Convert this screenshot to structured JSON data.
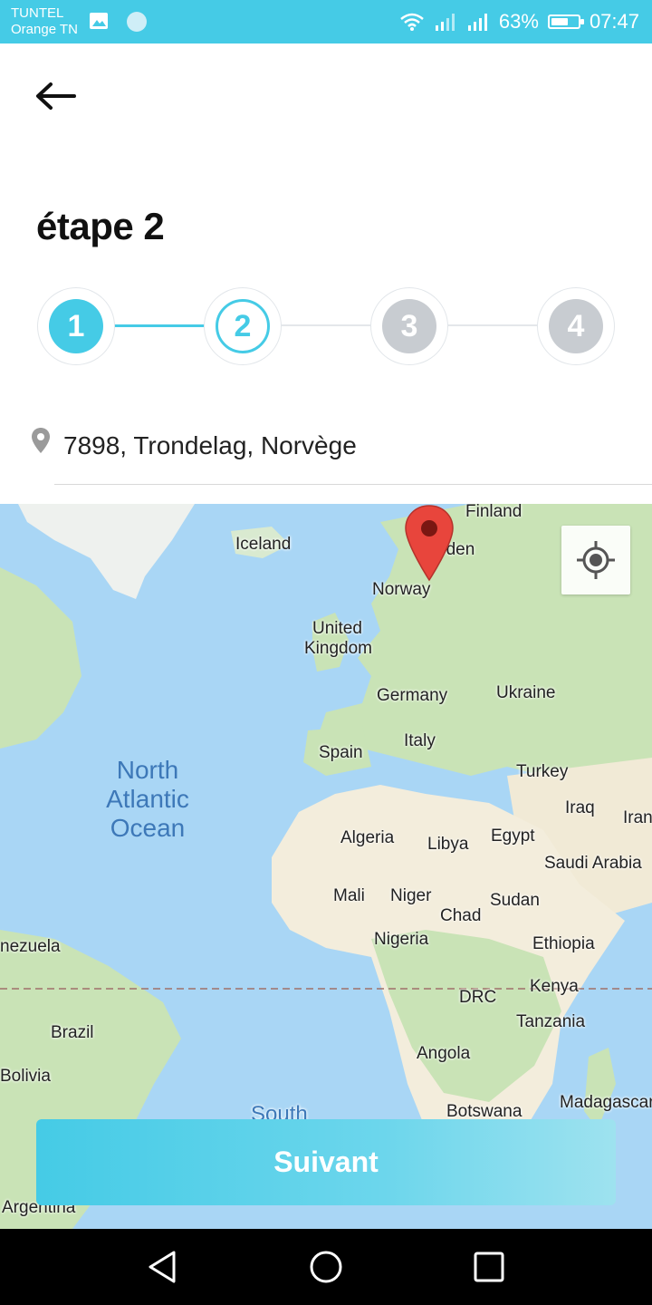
{
  "status_bar": {
    "carrier_line1": "TUNTEL",
    "carrier_line2": "Orange TN",
    "battery_percent": "63%",
    "battery_level": 0.63,
    "time": "07:47",
    "background_color": "#45cbe6"
  },
  "header": {
    "back_icon": "arrow-left-icon",
    "title": "étape 2"
  },
  "stepper": {
    "active_color": "#45cbe6",
    "inactive_color": "#c8ccd1",
    "steps": [
      {
        "label": "1",
        "state": "completed"
      },
      {
        "label": "2",
        "state": "current"
      },
      {
        "label": "3",
        "state": "upcoming"
      },
      {
        "label": "4",
        "state": "upcoming"
      }
    ]
  },
  "address": {
    "icon": "location-pin-icon",
    "value": "7898, Trondelag, Norvège"
  },
  "map": {
    "labels": {
      "finland": "Finland",
      "iceland": "Iceland",
      "sweden": "eden",
      "norway": "Norway",
      "uk_line1": "United",
      "uk_line2": "Kingdom",
      "germany": "Germany",
      "ukraine": "Ukraine",
      "spain": "Spain",
      "italy": "Italy",
      "turkey": "Turkey",
      "iraq": "Iraq",
      "iran": "Iran",
      "algeria": "Algeria",
      "libya": "Libya",
      "egypt": "Egypt",
      "saudi": "Saudi Arabia",
      "mali": "Mali",
      "niger": "Niger",
      "chad": "Chad",
      "sudan": "Sudan",
      "nigeria": "Nigeria",
      "ethiopia": "Ethiopia",
      "venezuela": "nezuela",
      "kenya": "Kenya",
      "drc": "DRC",
      "brazil": "Brazil",
      "tanzania": "Tanzania",
      "bolivia": "Bolivia",
      "angola": "Angola",
      "madagascar": "Madagascar",
      "botswana": "Botswana",
      "argentina": "Argentina",
      "south": "South"
    },
    "ocean_line1": "North",
    "ocean_line2": "Atlantic",
    "ocean_line3": "Ocean",
    "locate_icon": "my-location-icon",
    "pin_icon": "map-marker-icon",
    "water_color": "#a9d6f5",
    "land_color": "#c9e3b6"
  },
  "cta": {
    "label": "Suivant"
  },
  "nav_bar": {
    "back_icon": "triangle-back-icon",
    "home_icon": "circle-home-icon",
    "recents_icon": "square-recents-icon"
  }
}
